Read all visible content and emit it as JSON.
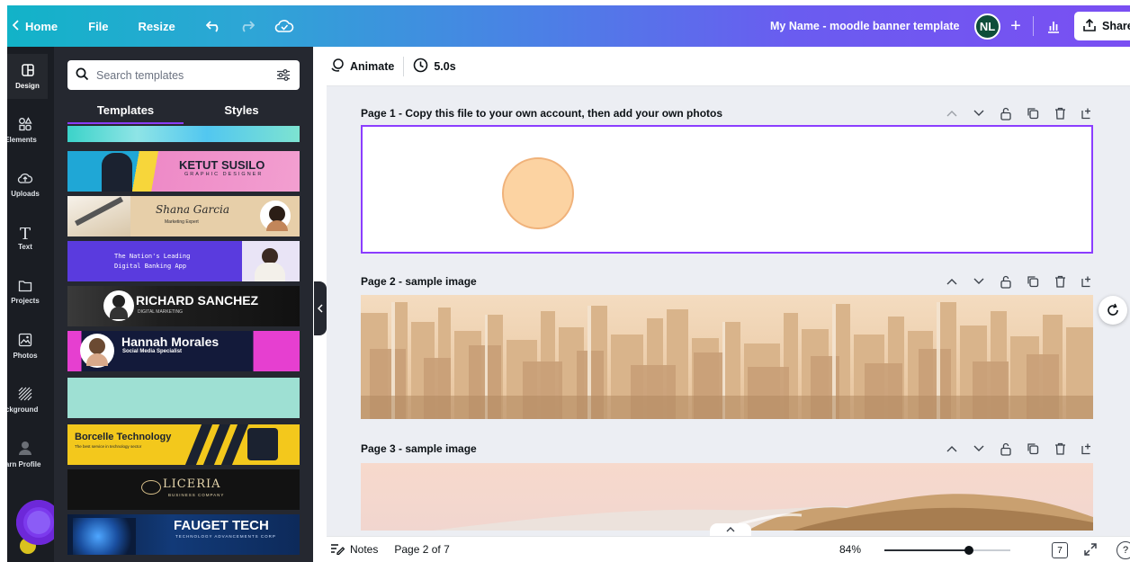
{
  "topbar": {
    "home_label": "Home",
    "file_label": "File",
    "resize_label": "Resize",
    "undo_icon": "undo-icon",
    "redo_icon": "redo-icon",
    "cloud_icon": "cloud-saved-icon",
    "document_title": "My Name - moodle banner template",
    "avatar_initials": "NL",
    "share_label": "Share"
  },
  "rail": {
    "items": [
      {
        "label": "Design",
        "icon": "layout-icon"
      },
      {
        "label": "Elements",
        "icon": "shapes-icon"
      },
      {
        "label": "Uploads",
        "icon": "cloud-upload-icon"
      },
      {
        "label": "Text",
        "icon": "text-icon"
      },
      {
        "label": "Projects",
        "icon": "folder-icon"
      },
      {
        "label": "Photos",
        "icon": "image-icon"
      },
      {
        "label": "Background",
        "icon": "hatch-icon"
      },
      {
        "label": "Learn Profile",
        "icon": "profile-icon"
      }
    ]
  },
  "panel": {
    "search_placeholder": "Search templates",
    "tabs": [
      {
        "label": "Templates",
        "active": true
      },
      {
        "label": "Styles",
        "active": false
      }
    ],
    "templates": [
      {
        "text": "",
        "bg": "gradient-aqua"
      },
      {
        "text": "KETUT SUSILO",
        "sub": "GRAPHIC DESIGNER",
        "bg": "#f29fd0"
      },
      {
        "text": "Shana Garcia",
        "sub": "Marketing Expert",
        "bg": "#e7cfa9"
      },
      {
        "text": "The Nation's Leading",
        "sub": "Digital Banking App",
        "bg": "#5a3bde"
      },
      {
        "text": "RICHARD SANCHEZ",
        "sub": "DIGITAL MARKETING",
        "bg": "#222222"
      },
      {
        "text": "Hannah Morales",
        "sub": "Social Media Specialist",
        "bg": "#131a3a"
      },
      {
        "text": "",
        "bg": "#9ee0d3"
      },
      {
        "text": "Borcelle Technology",
        "sub": "The best service in technology sector",
        "bg": "#f3c81c"
      },
      {
        "text": "LICERIA",
        "sub": "BUSINESS COMPANY",
        "bg": "#121212"
      },
      {
        "text": "FAUGET TECH",
        "sub": "TECHNOLOGY ADVANCEMENTS CORP",
        "bg": "#0d2a5a"
      }
    ]
  },
  "toolbar": {
    "animate_label": "Animate",
    "duration_label": "5.0s"
  },
  "pages": [
    {
      "title": "Page 1 - Copy this file to your own account, then add your own photos"
    },
    {
      "title": "Page 2 - sample image"
    },
    {
      "title": "Page 3 - sample image"
    }
  ],
  "footer": {
    "notes_label": "Notes",
    "page_indicator": "Page 2 of 7",
    "zoom_label": "84%",
    "zoom_level_percent": 84,
    "page_count_badge": "7",
    "help_label": "?"
  },
  "colors": {
    "accent": "#8b3dff",
    "panel_bg": "#252830",
    "rail_bg": "#1a1d23",
    "canvas_bg": "#eceef3"
  }
}
